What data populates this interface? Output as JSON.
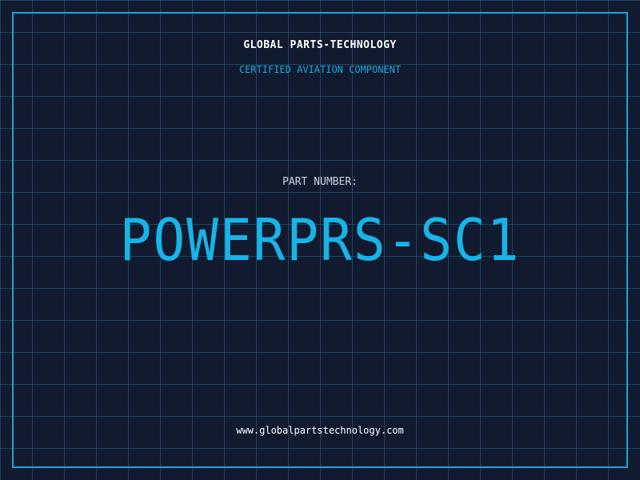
{
  "header": {
    "company": "GLOBAL PARTS-TECHNOLOGY",
    "tagline": "CERTIFIED AVIATION COMPONENT"
  },
  "main": {
    "label": "PART NUMBER:",
    "part_number": "POWERPRS-SC1"
  },
  "footer": {
    "website": "www.globalpartstechnology.com"
  },
  "colors": {
    "background": "#111a2e",
    "grid": "#1e6e96",
    "accent": "#17b4e8",
    "frame": "#1aa7d6"
  }
}
